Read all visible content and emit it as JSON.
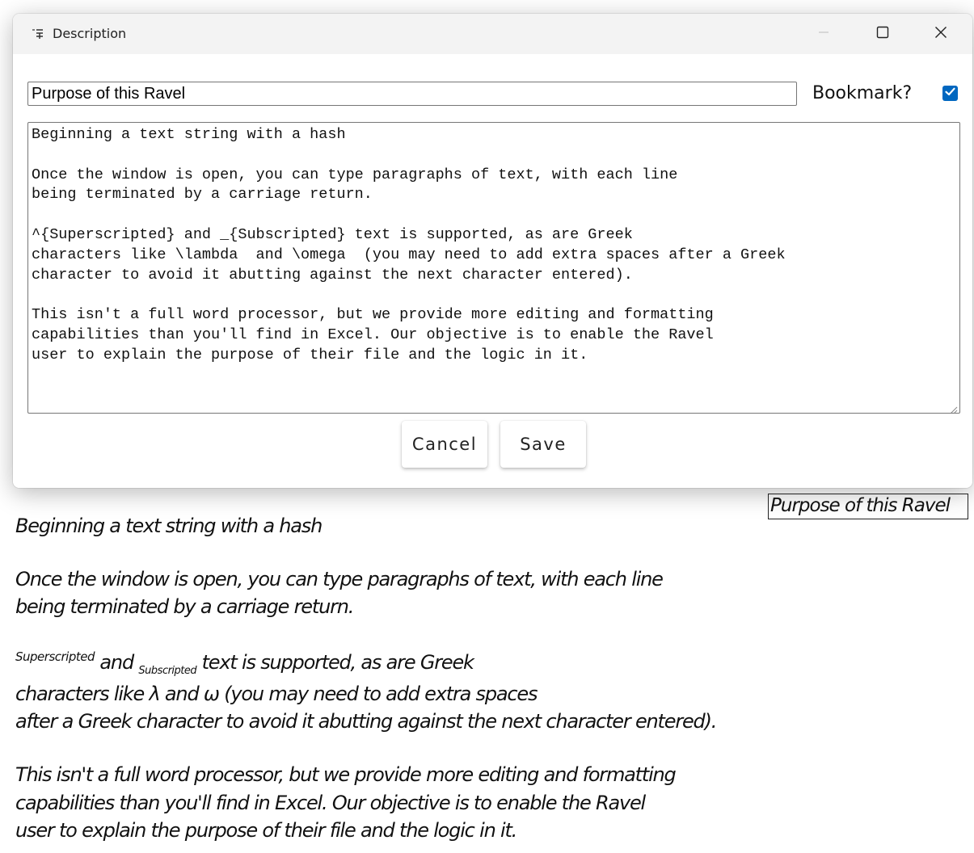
{
  "window": {
    "title": "Description",
    "controls": {
      "minimize": "minimize",
      "maximize": "maximize",
      "close": "close"
    }
  },
  "form": {
    "title_value": "Purpose of this Ravel",
    "bookmark_label": "Bookmark?",
    "bookmark_checked": true,
    "text_lines": [
      "Beginning a text string with a hash",
      "",
      "Once the window is open, you can type paragraphs of text, with each line",
      "being terminated by a carriage return.",
      "",
      "^{Superscripted} and _{Subscripted} text is supported, as are Greek",
      "characters like \\lambda  and \\omega  (you may need to add extra spaces after a Greek",
      "character to avoid it abutting against the next character entered).",
      "",
      "This isn't a full word processor, but we provide more editing and formatting",
      "capabilities than you'll find in Excel. Our objective is to enable the Ravel",
      "user to explain the purpose of their file and the logic in it."
    ],
    "cancel_label": "Cancel",
    "save_label": "Save"
  },
  "rendered": {
    "title": "Purpose of this Ravel",
    "line1": "Beginning a text string with a hash",
    "line2": "Once the window is open, you can type paragraphs of text, with each line",
    "line3": "being terminated by a carriage return.",
    "line4_sup": "Superscripted",
    "line4_and": " and ",
    "line4_sub": "Subscripted",
    "line4_rest": " text is supported, as are Greek",
    "line5": "characters like λ and ω (you may need to add extra spaces",
    "line6": "after a Greek character to avoid it abutting against the next character entered).",
    "line7": "This isn't a full word processor, but we provide more editing and formatting",
    "line8": "capabilities than you'll find in Excel. Our objective is to enable the Ravel",
    "line9": "user to explain the purpose of their file and the logic in it."
  },
  "colors": {
    "checkbox": "#0067c0",
    "titlebar": "#f3f3f3"
  }
}
